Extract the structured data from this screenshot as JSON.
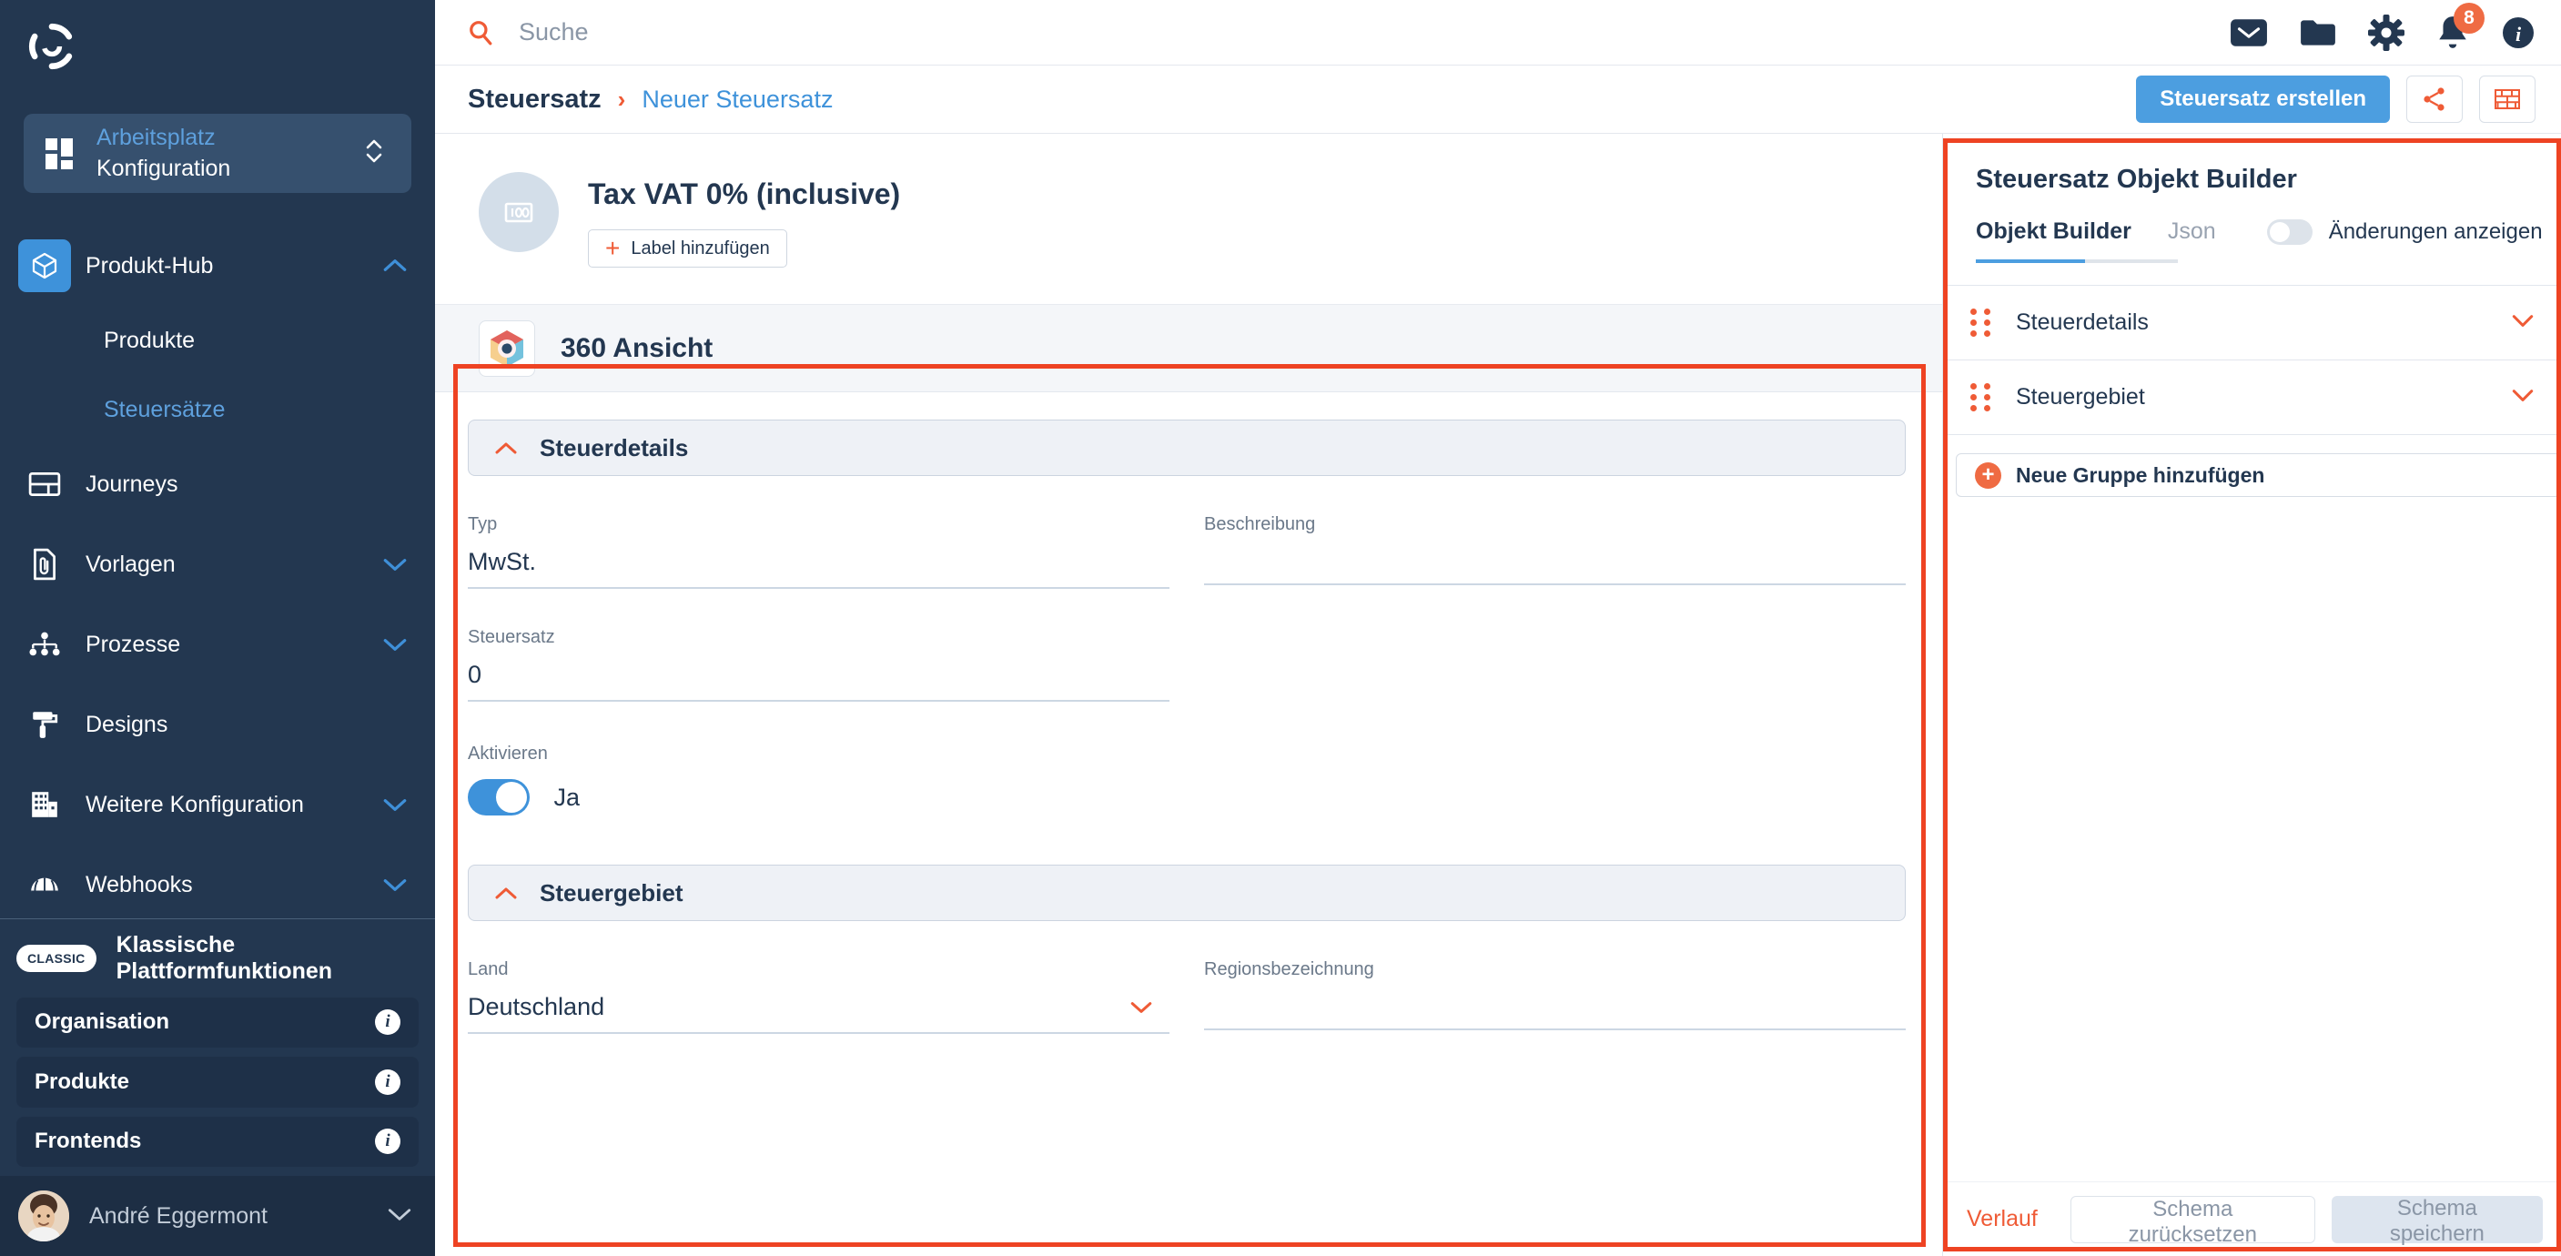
{
  "sidebar": {
    "workspace": {
      "top_label": "Arbeitsplatz",
      "bottom_label": "Konfiguration",
      "icon": "grid-icon"
    },
    "nav": [
      {
        "label": "Produkt-Hub",
        "icon": "cube-icon",
        "expanded": true,
        "chevron": "chevron-up",
        "highlighted": true
      },
      {
        "label": "Produkte",
        "sub": true,
        "selected": false
      },
      {
        "label": "Steuersätze",
        "sub": true,
        "selected": true
      },
      {
        "label": "Journeys",
        "icon": "layout-icon",
        "chevron": ""
      },
      {
        "label": "Vorlagen",
        "icon": "document-clip-icon",
        "chevron": "chevron-down"
      },
      {
        "label": "Prozesse",
        "icon": "hierarchy-icon",
        "chevron": "chevron-down"
      },
      {
        "label": "Designs",
        "icon": "paint-roller-icon",
        "chevron": ""
      },
      {
        "label": "Weitere Konfiguration",
        "icon": "building-icon",
        "chevron": "chevron-down"
      },
      {
        "label": "Webhooks",
        "icon": "globe-icon",
        "chevron": "chevron-down"
      }
    ],
    "classic": {
      "pill": "CLASSIC",
      "label": "Klassische Plattformfunktionen"
    },
    "config_items": [
      {
        "label": "Organisation",
        "icon": "info-icon"
      },
      {
        "label": "Produkte",
        "icon": "info-icon"
      },
      {
        "label": "Frontends",
        "icon": "info-icon"
      }
    ],
    "user": {
      "name": "André Eggermont",
      "chevron": "chevron-down",
      "avatar": "user-avatar"
    }
  },
  "topbar": {
    "search": {
      "placeholder": "Suche",
      "value": "",
      "icon": "search-icon"
    },
    "icons": [
      {
        "name": "mail-icon"
      },
      {
        "name": "folder-icon"
      },
      {
        "name": "gear-icon"
      },
      {
        "name": "bell-icon",
        "badge": "8"
      },
      {
        "name": "info-icon"
      }
    ]
  },
  "breadcrumb": {
    "root": "Steuersatz",
    "separator": "›",
    "leaf": "Neuer Steuersatz",
    "primary_button": "Steuersatz erstellen",
    "share_icon": "share-icon",
    "wall_icon": "brick-wall-icon"
  },
  "record": {
    "avatar_icon": "banknote-100-icon",
    "title": "Tax VAT 0% (inclusive)",
    "add_label_button": "Label hinzufügen",
    "plus_icon": "plus-icon"
  },
  "view": {
    "icon": "360-view-icon",
    "title": "360 Ansicht"
  },
  "form": {
    "sections": [
      {
        "title": "Steuerdetails",
        "chevron": "chevron-up",
        "fields_left": [
          {
            "label": "Typ",
            "value": "MwSt."
          },
          {
            "label": "Steuersatz",
            "value": "0"
          }
        ],
        "fields_right": [
          {
            "label": "Beschreibung",
            "value": ""
          }
        ],
        "toggle": {
          "label": "Aktivieren",
          "state_text": "Ja",
          "on": true
        }
      },
      {
        "title": "Steuergebiet",
        "chevron": "chevron-up",
        "fields_left": [
          {
            "label": "Land",
            "value": "Deutschland",
            "dropdown": true
          }
        ],
        "fields_right": [
          {
            "label": "Regionsbezeichnung",
            "value": ""
          }
        ]
      }
    ]
  },
  "builder": {
    "title": "Steuersatz Objekt Builder",
    "tabs": [
      {
        "label": "Objekt Builder",
        "active": true
      },
      {
        "label": "Json",
        "active": false
      }
    ],
    "changes_toggle": {
      "label": "Änderungen anzeigen",
      "on": false
    },
    "groups": [
      {
        "label": "Steuerdetails",
        "grip": "drag-handle-icon",
        "chevron": "chevron-down"
      },
      {
        "label": "Steuergebiet",
        "grip": "drag-handle-icon",
        "chevron": "chevron-down"
      }
    ],
    "add_group_button": "Neue Gruppe hinzufügen",
    "footer": {
      "history_link": "Verlauf",
      "reset_button": "Schema zurücksetzen",
      "save_button": "Schema speichern"
    }
  },
  "colors": {
    "sidebar_bg": "#233750",
    "accent_blue": "#3e92da",
    "accent_orange": "#ef5b36",
    "annotation_red": "#ee4323"
  }
}
